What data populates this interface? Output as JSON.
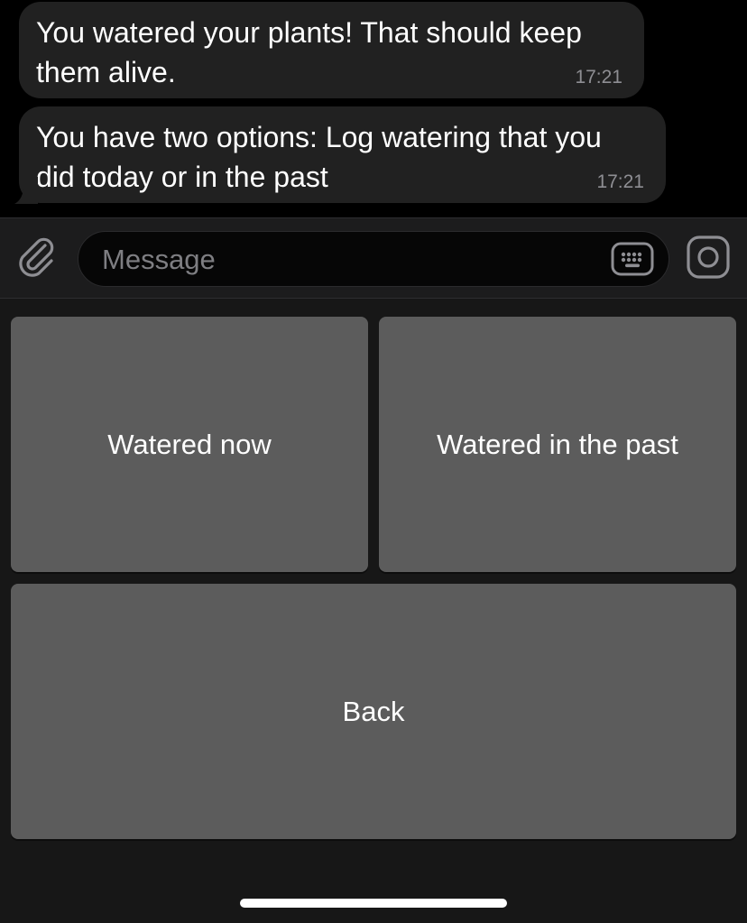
{
  "messages": [
    {
      "text": "You watered your plants! That should keep them alive.",
      "time": "17:21"
    },
    {
      "text": "You have two options: Log watering that you did today or in the past",
      "time": "17:21"
    }
  ],
  "input_bar": {
    "placeholder": "Message",
    "icons": {
      "attach": "paperclip-icon",
      "keyboard": "keyboard-icon",
      "camera": "camera-icon"
    }
  },
  "reply_keyboard": {
    "buttons": [
      {
        "label": "Watered now"
      },
      {
        "label": "Watered in the past"
      },
      {
        "label": "Back"
      }
    ]
  },
  "colors": {
    "chat_background": "#000000",
    "bubble": "#212121",
    "timestamp": "#8e8e93",
    "keyboard_background": "#171717",
    "keyboard_button": "#5c5c5c"
  }
}
